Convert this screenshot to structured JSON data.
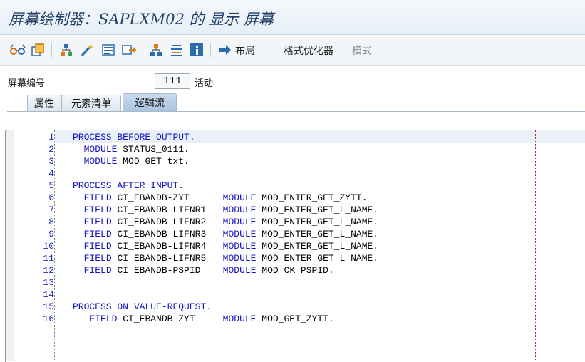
{
  "window": {
    "title": "屏幕绘制器：SAPLXM02 的 显示 屏幕"
  },
  "toolbar": {
    "icons": [
      "glasses-icon",
      "copy-object-icon",
      "hierarchy-icon",
      "magic-wand-icon",
      "element-list-icon",
      "layout-export-icon",
      "hierarchy-tree-icon",
      "align-icon",
      "info-icon",
      "arrow-right-icon"
    ],
    "layout_label": "布局",
    "format_label": "格式优化器",
    "mode_label": "模式"
  },
  "screen": {
    "label": "屏幕编号",
    "number": "111",
    "status": "活动"
  },
  "tabs": [
    {
      "label": "属性"
    },
    {
      "label": "元素清单"
    },
    {
      "label": "逻辑流"
    }
  ],
  "editor": {
    "lines": [
      {
        "num": "1",
        "text": "PROCESS BEFORE OUTPUT."
      },
      {
        "num": "2",
        "text": "  MODULE STATUS_0111."
      },
      {
        "num": "3",
        "text": "  MODULE MOD_GET_txt."
      },
      {
        "num": "4",
        "text": ""
      },
      {
        "num": "5",
        "text": "PROCESS AFTER INPUT."
      },
      {
        "num": "6",
        "text": "  FIELD CI_EBANDB-ZYT      MODULE MOD_ENTER_GET_ZYTT."
      },
      {
        "num": "7",
        "text": "  FIELD CI_EBANDB-LIFNR1   MODULE MOD_ENTER_GET_L_NAME."
      },
      {
        "num": "8",
        "text": "  FIELD CI_EBANDB-LIFNR2   MODULE MOD_ENTER_GET_L_NAME."
      },
      {
        "num": "9",
        "text": "  FIELD CI_EBANDB-LIFNR3   MODULE MOD_ENTER_GET_L_NAME."
      },
      {
        "num": "10",
        "text": "  FIELD CI_EBANDB-LIFNR4   MODULE MOD_ENTER_GET_L_NAME."
      },
      {
        "num": "11",
        "text": "  FIELD CI_EBANDB-LIFNR5   MODULE MOD_ENTER_GET_L_NAME."
      },
      {
        "num": "12",
        "text": "  FIELD CI_EBANDB-PSPID    MODULE MOD_CK_PSPID."
      },
      {
        "num": "13",
        "text": ""
      },
      {
        "num": "14",
        "text": ""
      },
      {
        "num": "15",
        "text": "PROCESS ON VALUE-REQUEST."
      },
      {
        "num": "16",
        "text": "   FIELD CI_EBANDB-ZYT     MODULE MOD_GET_ZYTT."
      }
    ]
  },
  "colors": {
    "title": "#1f3e66",
    "keyword": "#1414c8",
    "line_number": "#2323c8",
    "margin_line": "#d02020"
  }
}
